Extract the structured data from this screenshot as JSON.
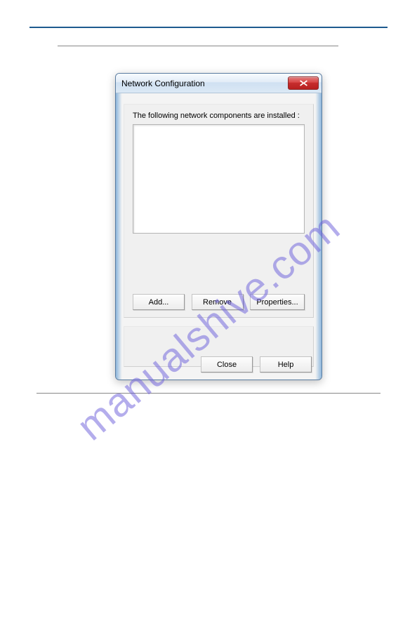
{
  "watermark": "manualshive.com",
  "dialog": {
    "title": "Network Configuration",
    "components_label": "The following network components are installed :",
    "buttons": {
      "add": "Add...",
      "remove": "Remove",
      "properties": "Properties...",
      "close": "Close",
      "help": "Help"
    }
  }
}
